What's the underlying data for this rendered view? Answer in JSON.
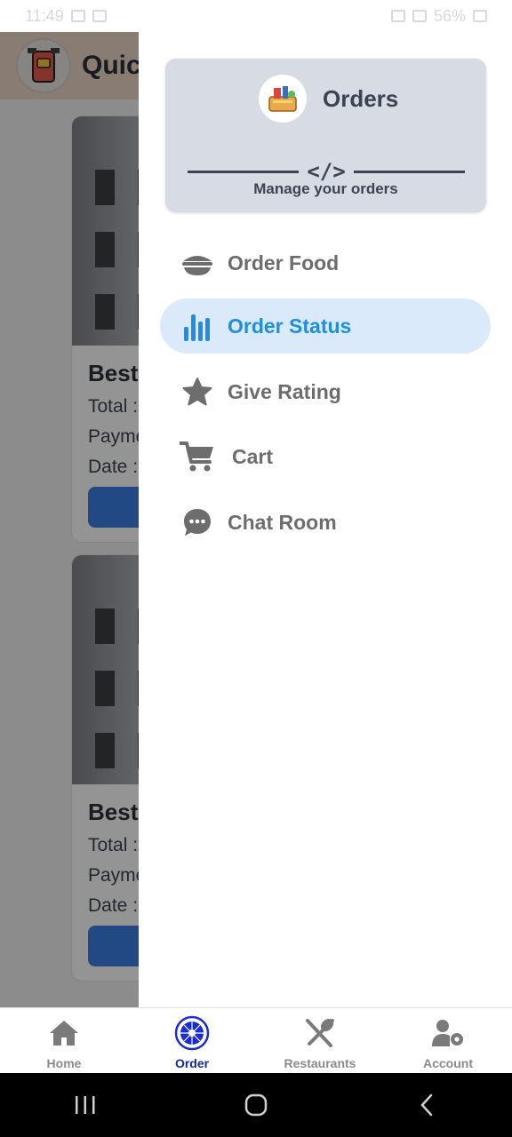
{
  "status_bar": {
    "time": "11:49",
    "battery": "56%"
  },
  "background_app": {
    "title": "Quic",
    "cards": [
      {
        "title": "Best",
        "total": "Total :",
        "payment": "Payme",
        "date": "Date :"
      },
      {
        "title": "Best",
        "total": "Total :",
        "payment": "Payme",
        "date": "Date :"
      }
    ]
  },
  "drawer": {
    "header": {
      "title": "Orders",
      "subtitle": "Manage your orders",
      "code_glyph": "</>"
    },
    "items": [
      {
        "label": "Order Food",
        "icon": "bowl-icon",
        "active": false
      },
      {
        "label": "Order Status",
        "icon": "bar-chart-icon",
        "active": true
      },
      {
        "label": "Give Rating",
        "icon": "star-icon",
        "active": false
      },
      {
        "label": "Cart",
        "icon": "cart-icon",
        "active": false
      },
      {
        "label": "Chat Room",
        "icon": "chat-icon",
        "active": false
      }
    ]
  },
  "bottom_nav": {
    "items": [
      {
        "label": "Home",
        "icon": "home-icon",
        "active": false
      },
      {
        "label": "Order",
        "icon": "order-wheel-icon",
        "active": true
      },
      {
        "label": "Restaurants",
        "icon": "utensils-icon",
        "active": false
      },
      {
        "label": "Account",
        "icon": "user-settings-icon",
        "active": false
      }
    ]
  },
  "colors": {
    "accent": "#1e8ee0",
    "active_bg": "#dbeafb",
    "nav_active": "#0b2aa8",
    "header_bg": "#d7dbe4"
  }
}
